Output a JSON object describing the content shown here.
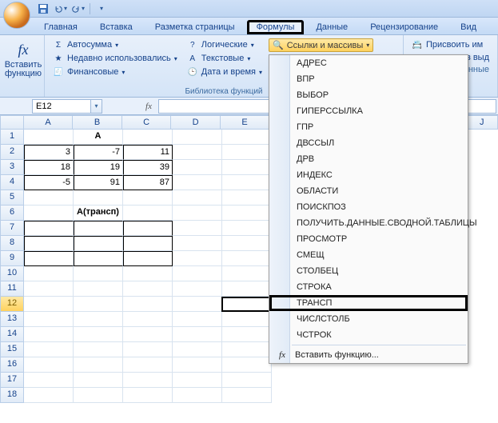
{
  "qat": {
    "save": "save-icon",
    "undo": "undo-icon",
    "redo": "redo-icon"
  },
  "tabs": {
    "home": "Главная",
    "insert": "Вставка",
    "pagelayout": "Разметка страницы",
    "formulas": "Формулы",
    "data": "Данные",
    "review": "Рецензирование",
    "view": "Вид"
  },
  "ribbon": {
    "insert_fn": {
      "label": "Вставить\nфункцию",
      "glyph": "fx"
    },
    "autosum": "Автосумма",
    "recent": "Недавно использовались",
    "financial": "Финансовые",
    "logical": "Логические",
    "text": "Текстовые",
    "datetime": "Дата и время",
    "lookup": "Ссылки и массивы",
    "define_name": "Присвоить им",
    "from_sel": "ть из выд",
    "names_trace": "еленные",
    "library_label": "Библиотека функций"
  },
  "namebox": {
    "value": "E12"
  },
  "fx_glyph": "fx",
  "columns": [
    "A",
    "B",
    "C",
    "D",
    "E",
    "",
    "",
    "",
    "",
    "J"
  ],
  "rows": [
    "1",
    "2",
    "3",
    "4",
    "5",
    "6",
    "7",
    "8",
    "9",
    "10",
    "11",
    "12",
    "13",
    "14",
    "15",
    "16",
    "17",
    "18"
  ],
  "sheet": {
    "title1": "A",
    "r2": {
      "a": "3",
      "b": "-7",
      "c": "11"
    },
    "r3": {
      "a": "18",
      "b": "19",
      "c": "39"
    },
    "r4": {
      "a": "-5",
      "b": "91",
      "c": "87"
    },
    "title2": "А(трансп)"
  },
  "dropdown": {
    "items": [
      "АДРЕС",
      "ВПР",
      "ВЫБОР",
      "ГИПЕРССЫЛКА",
      "ГПР",
      "ДВССЫЛ",
      "ДРВ",
      "ИНДЕКС",
      "ОБЛАСТИ",
      "ПОИСКПОЗ",
      "ПОЛУЧИТЬ.ДАННЫЕ.СВОДНОЙ.ТАБЛИЦЫ",
      "ПРОСМОТР",
      "СМЕЩ",
      "СТОЛБЕЦ",
      "СТРОКА",
      "ТРАНСП",
      "ЧИСЛСТОЛБ",
      "ЧСТРОК"
    ],
    "highlight_index": 15,
    "footer": "Вставить функцию..."
  }
}
